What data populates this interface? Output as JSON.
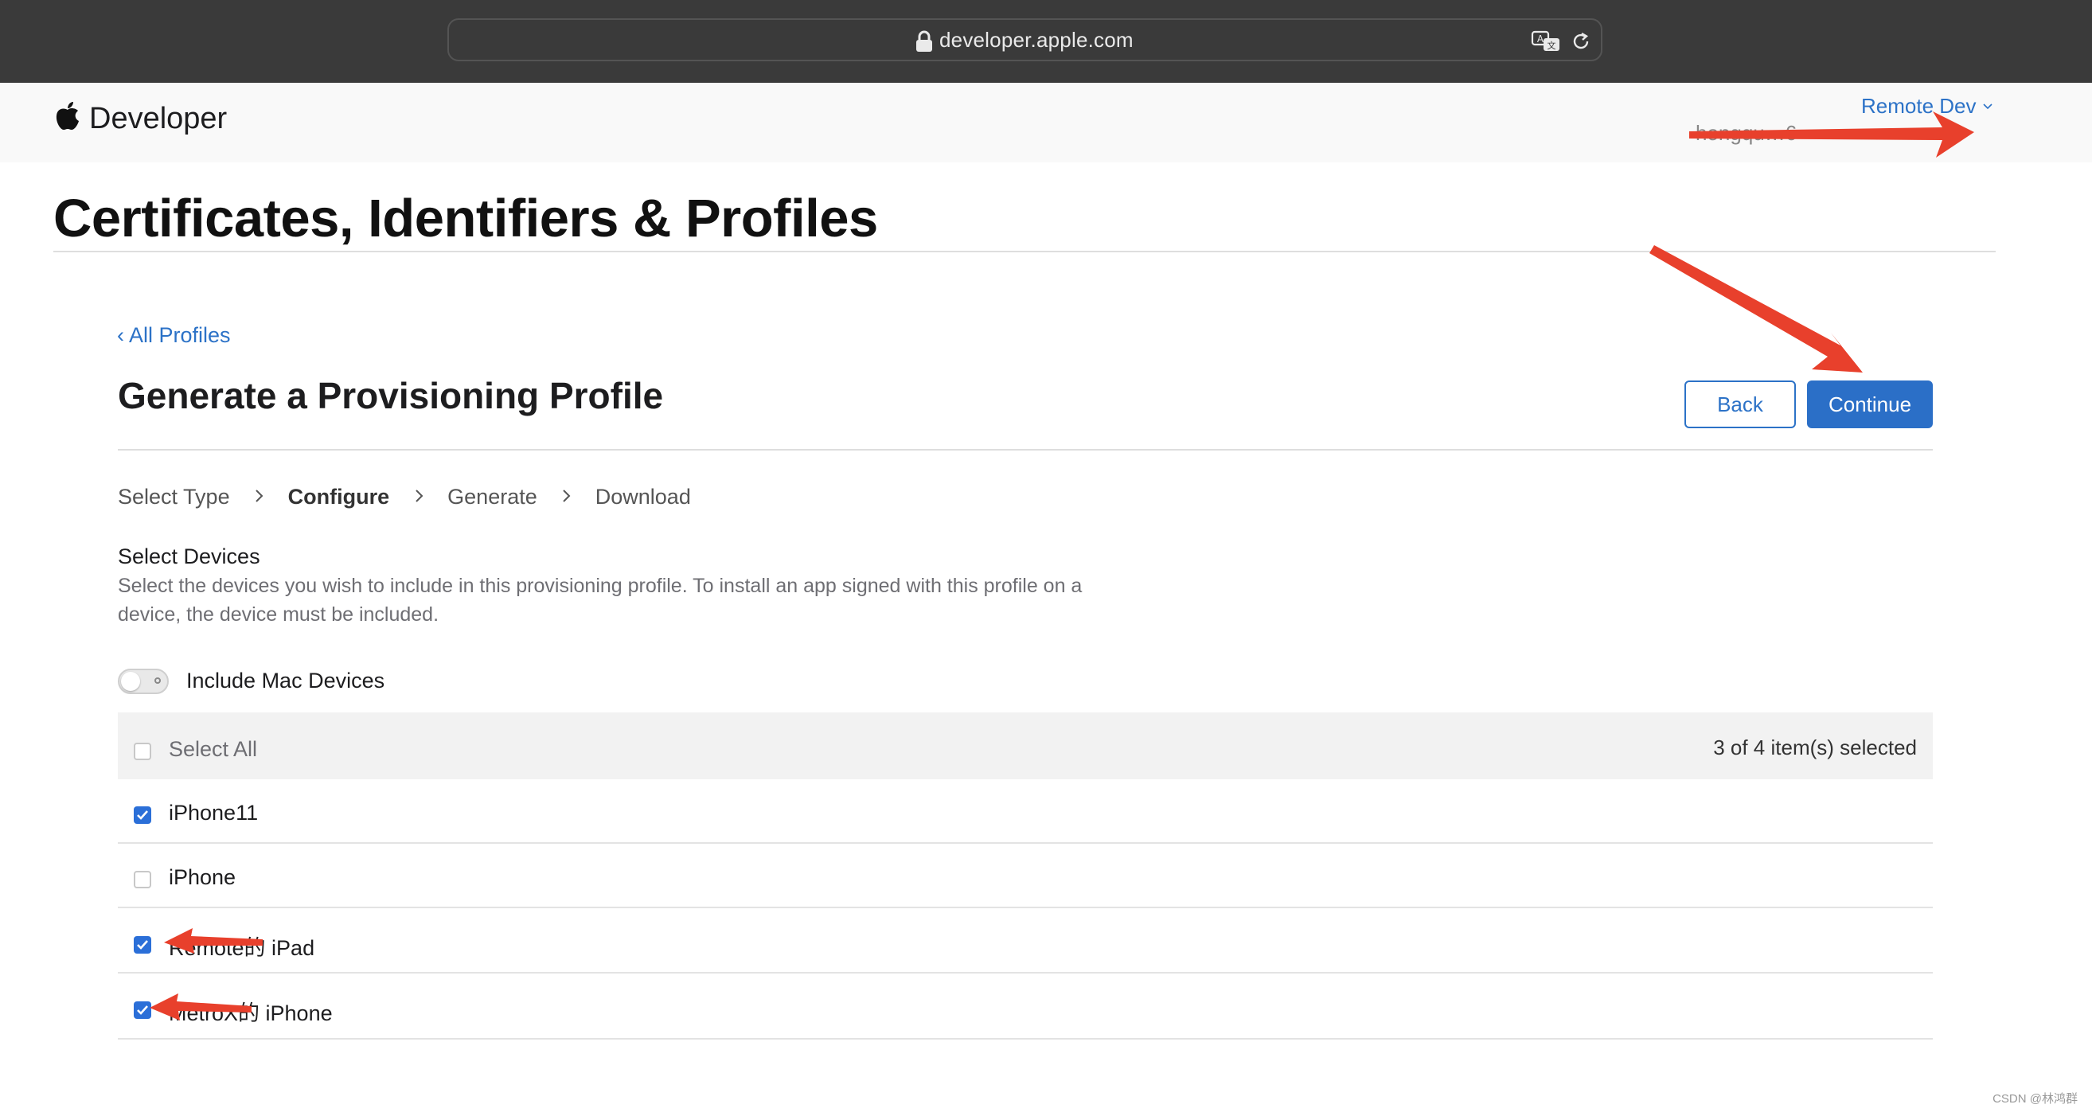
{
  "browser": {
    "url": "developer.apple.com"
  },
  "header": {
    "brand": "Developer",
    "account_name": "Remote Dev",
    "account_id": "hongqu…6"
  },
  "page": {
    "title": "Certificates, Identifiers & Profiles"
  },
  "profile": {
    "back_link": "‹ All Profiles",
    "title": "Generate a Provisioning Profile",
    "back_button": "Back",
    "continue_button": "Continue",
    "steps": [
      {
        "label": "Select Type",
        "active": false
      },
      {
        "label": "Configure",
        "active": true
      },
      {
        "label": "Generate",
        "active": false
      },
      {
        "label": "Download",
        "active": false
      }
    ]
  },
  "devices": {
    "title": "Select Devices",
    "description": "Select the devices you wish to include in this provisioning profile. To install an app signed with this profile on a device, the device must be included.",
    "include_mac_label": "Include Mac Devices",
    "include_mac_on": false,
    "select_all_label": "Select All",
    "selected_count": "3 of 4 item(s) selected",
    "items": [
      {
        "name": "iPhone11",
        "checked": true
      },
      {
        "name": "iPhone",
        "checked": false
      },
      {
        "name": "Remote的 iPad",
        "checked": true
      },
      {
        "name": "MetroX的 iPhone",
        "checked": true
      }
    ]
  },
  "watermark": "CSDN @林鸿群",
  "colors": {
    "accent": "#2c72c7",
    "annotation_arrow": "#e8402c",
    "checkbox_on": "#2b6fd8"
  }
}
